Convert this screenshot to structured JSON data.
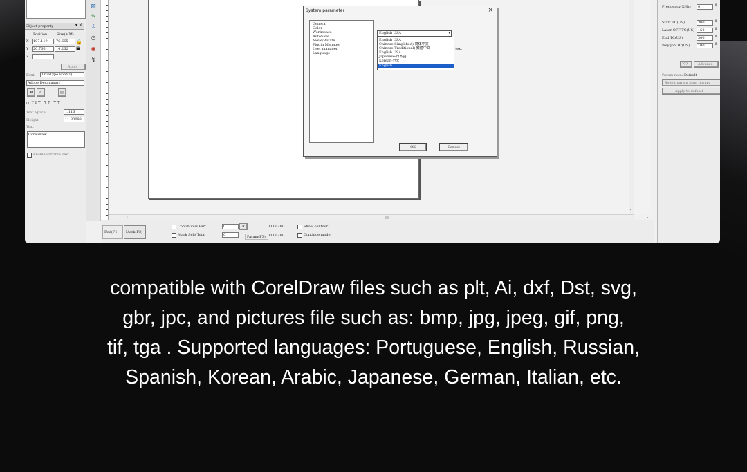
{
  "left_panel": {
    "object_property_title": "Object property",
    "col_position": "Position",
    "col_size": "Size(MM)",
    "x_label": "X",
    "y_label": "Y",
    "z_label": "Z",
    "x_value": "107.119",
    "y_value": "20.766",
    "size_w": "76.665",
    "size_h": "14.262",
    "apply_button": "Apply",
    "font_label": "Font",
    "font_value": "TrueType Font(T)",
    "font_name": "Adobe Devanagari",
    "text_space_label": "Text Space",
    "text_space_value": "1.116",
    "height_label": "Height",
    "height_value": "11.30098",
    "text_label": "Text",
    "text_value": "Coreldraw",
    "enable_variable_text": "Enable variable Text"
  },
  "dialog": {
    "title": "System parameter",
    "tree_items": [
      "General",
      "Color",
      "Workspace",
      "AutoSave",
      "Move/Rotate",
      "Plugin Manager",
      "User manager",
      "Language"
    ],
    "selected_language": "English USA",
    "options": [
      "English USA",
      "Chinese(Simplified)-简体中文",
      "Chinese(Traditional)-繁體中文",
      "English USA",
      "Japanese-日本語",
      "Korean-한국",
      "English"
    ],
    "selected_option_index": 6,
    "side_text": "l text",
    "ok_button": "OK",
    "cancel_button": "Cancel"
  },
  "bottom_bar": {
    "red_button": "Red(F1)",
    "mark_button": "Mark(F2)",
    "continuous_part": "Continuous Part",
    "part_value": "0",
    "mark_selected_total": "Mark Sele Total",
    "total_value": "0",
    "time1": "00:00:00",
    "time2": "00:00:00",
    "param_button": "Param(F3)",
    "show_contour": "Show contour",
    "continue_mode": "Continue mode"
  },
  "right_panel": {
    "frequency_label": "Frequency(KHz)",
    "frequency_value": "0",
    "start_tc_label": "Start TC(US)",
    "start_tc_value": "300",
    "laser_off_tc_label": "Laser OFF TC(US)",
    "laser_off_tc_value": "150",
    "end_tc_label": "End TC(US)",
    "end_tc_value": "300",
    "polygon_tc_label": "Polygon TC(US)",
    "polygon_tc_value": "100",
    "reset_button": "???",
    "advance_button": "Advance",
    "param_name_label": "Param name",
    "param_name_value": "Default",
    "select_param_button": "Select param from library",
    "apply_default_button": "Apply to default"
  },
  "caption": {
    "line1": "compatible with CorelDraw files such as plt, Ai, dxf, Dst, svg,",
    "line2": "gbr, jpc, and pictures file such as: bmp, jpg, jpeg, gif, png,",
    "line3": "tif, tga . Supported languages: Portuguese, English, Russian,",
    "line4": "Spanish, Korean, Arabic, Japanese, German, Italian, etc."
  }
}
